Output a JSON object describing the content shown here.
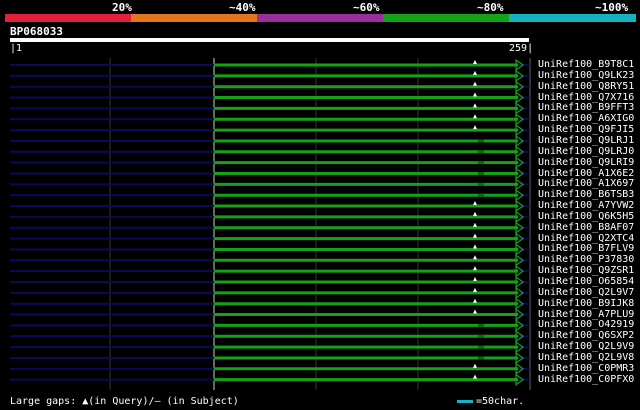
{
  "legend": {
    "labels": [
      "20%",
      "~40%",
      "~60%",
      "~80%",
      "~100%"
    ],
    "colors": [
      "#e3203a",
      "#e2761e",
      "#9a2e9a",
      "#16a216",
      "#16b2c2"
    ]
  },
  "query": {
    "name": "BP068033",
    "start_label": "1",
    "end_label": "259"
  },
  "hits": [
    {
      "label": "UniRef100_B9T8C1",
      "gap_marker": true
    },
    {
      "label": "UniRef100_Q9LK23",
      "gap_marker": true
    },
    {
      "label": "UniRef100_Q8RY51",
      "gap_marker": true
    },
    {
      "label": "UniRef100_Q7X716",
      "gap_marker": true
    },
    {
      "label": "UniRef100_B9FFT3",
      "gap_marker": true
    },
    {
      "label": "UniRef100_A6XIG0",
      "gap_marker": true
    },
    {
      "label": "UniRef100_Q9FJI5",
      "gap_marker": true
    },
    {
      "label": "UniRef100_Q9LRJ1",
      "gap_marker": false
    },
    {
      "label": "UniRef100_Q9LRJ0",
      "gap_marker": false
    },
    {
      "label": "UniRef100_Q9LRI9",
      "gap_marker": false
    },
    {
      "label": "UniRef100_A1X6E2",
      "gap_marker": false
    },
    {
      "label": "UniRef100_A1X697",
      "gap_marker": false
    },
    {
      "label": "UniRef100_B6TSB3",
      "gap_marker": false
    },
    {
      "label": "UniRef100_A7YVW2",
      "gap_marker": true
    },
    {
      "label": "UniRef100_Q6K5H5",
      "gap_marker": true
    },
    {
      "label": "UniRef100_B8AF07",
      "gap_marker": true
    },
    {
      "label": "UniRef100_Q2XTC4",
      "gap_marker": true
    },
    {
      "label": "UniRef100_B7FLV9",
      "gap_marker": true
    },
    {
      "label": "UniRef100_P37830",
      "gap_marker": true
    },
    {
      "label": "UniRef100_Q9ZSR1",
      "gap_marker": true
    },
    {
      "label": "UniRef100_O65854",
      "gap_marker": true
    },
    {
      "label": "UniRef100_Q2L9V7",
      "gap_marker": true
    },
    {
      "label": "UniRef100_B9IJK8",
      "gap_marker": true
    },
    {
      "label": "UniRef100_A7PLU9",
      "gap_marker": true
    },
    {
      "label": "UniRef100_O42919",
      "gap_marker": false
    },
    {
      "label": "UniRef100_Q6SXP2",
      "gap_marker": false
    },
    {
      "label": "UniRef100_Q2L9V9",
      "gap_marker": false
    },
    {
      "label": "UniRef100_Q2L9V8",
      "gap_marker": false
    },
    {
      "label": "UniRef100_C0PMR3",
      "gap_marker": true
    },
    {
      "label": "UniRef100_C0PFX0",
      "gap_marker": true
    }
  ],
  "footer": {
    "large_gaps_text": "Large gaps: ▲(in Query)/– (in Subject)",
    "scale_text": "=50char.",
    "scale_color": "#16b2c2"
  },
  "colors": {
    "hit_line": "#16a216",
    "unaligned_line": "#0a0a5a",
    "grid": "#333333"
  }
}
